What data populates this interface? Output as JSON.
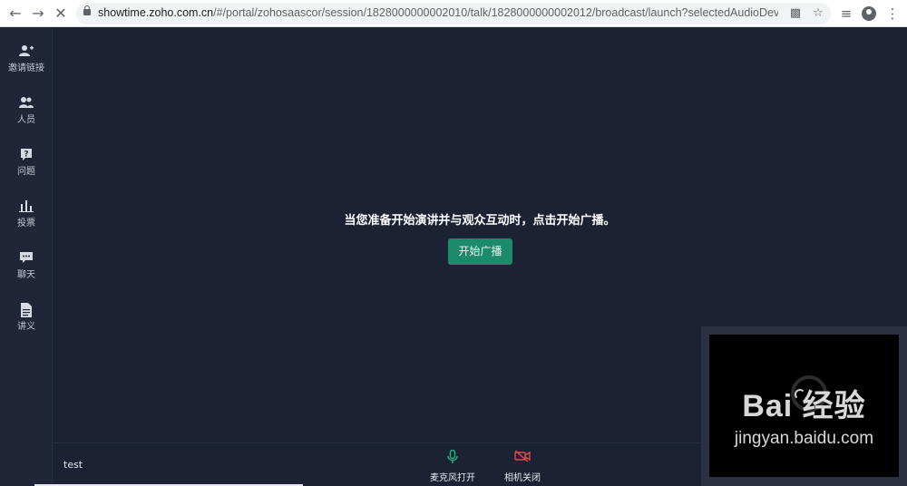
{
  "browser": {
    "url_host": "showtime.zoho.com.cn",
    "url_path": "/#/portal/zohosaascor/session/1828000000002010/talk/1828000000002012/broadcast/launch?selectedAudioDevice=...",
    "back_icon": "arrow-left-icon",
    "forward_icon": "arrow-right-icon",
    "close_icon": "close-icon"
  },
  "sidebar": {
    "items": [
      {
        "label": "邀请链接",
        "icon": "add-user-icon"
      },
      {
        "label": "人员",
        "icon": "people-icon"
      },
      {
        "label": "问题",
        "icon": "question-icon"
      },
      {
        "label": "投票",
        "icon": "poll-icon"
      },
      {
        "label": "聊天",
        "icon": "chat-icon"
      },
      {
        "label": "讲义",
        "icon": "document-icon"
      }
    ]
  },
  "main": {
    "prompt": "当您准备开始演讲并与观众互动时，点击开始广播。",
    "start_button": "开始广播"
  },
  "bottom": {
    "title": "test",
    "mic_label": "麦克风打开",
    "camera_label": "相机关闭"
  },
  "watermark": {
    "main": "Bai 经验",
    "sub": "jingyan.baidu.com"
  },
  "colors": {
    "background": "#1b2233",
    "accent": "#1e8a6c",
    "mic_on": "#1fb37f",
    "camera_off": "#e04b4b"
  }
}
